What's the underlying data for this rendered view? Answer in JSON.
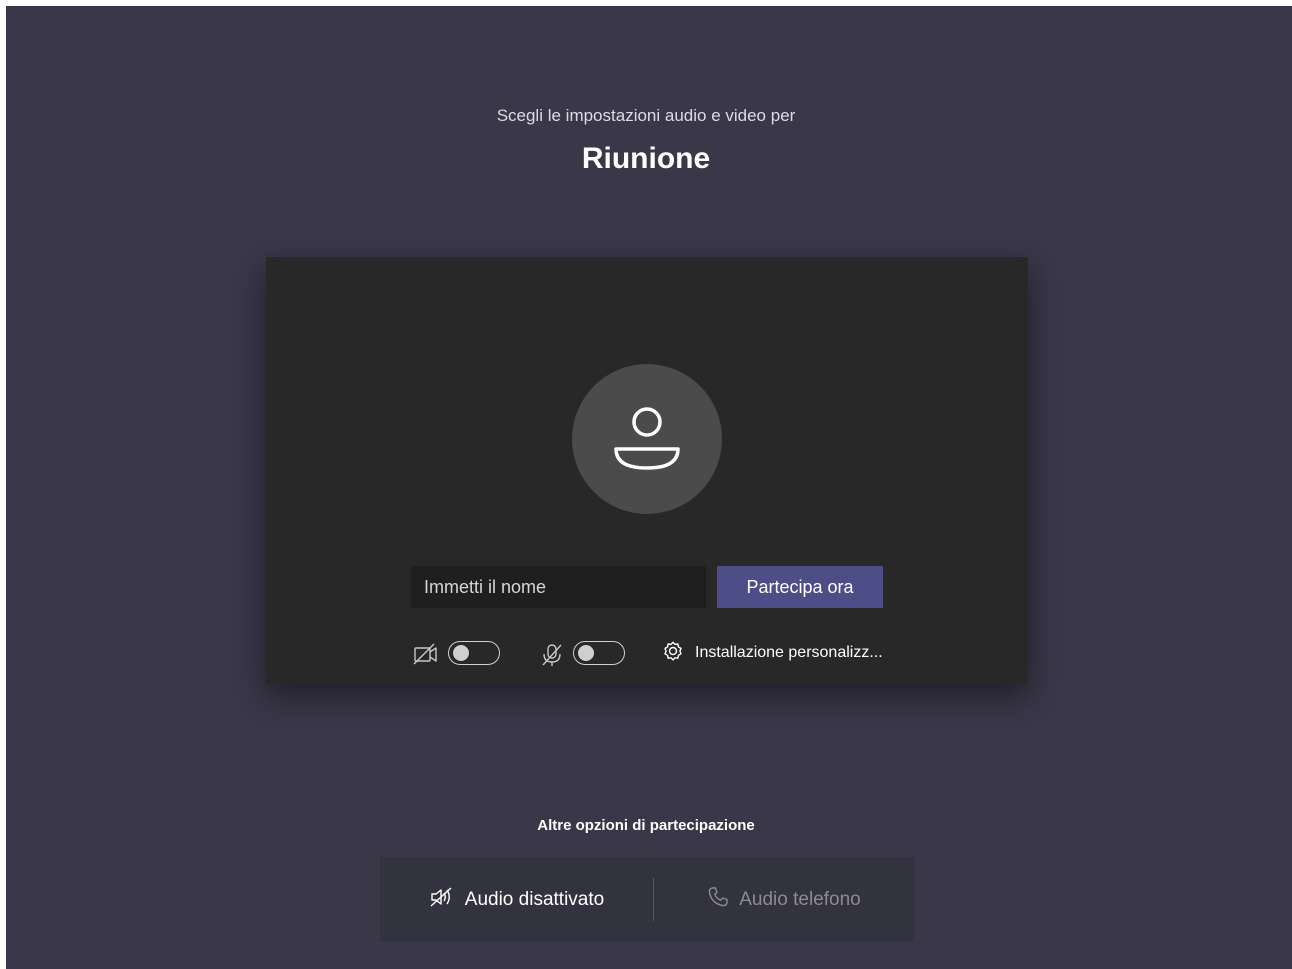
{
  "header": {
    "subtitle": "Scegli le impostazioni audio e video per",
    "title": "Riunione"
  },
  "join_card": {
    "name_placeholder": "Immetti il nome",
    "name_value": "",
    "join_button_label": "Partecipa ora",
    "camera_toggle": {
      "icon": "camera-off-icon",
      "state": "off"
    },
    "mic_toggle": {
      "icon": "mic-off-icon",
      "state": "off"
    },
    "settings_link": {
      "icon": "gear-icon",
      "label": "Installazione personalizz..."
    }
  },
  "other_options": {
    "heading": "Altre opzioni di partecipazione",
    "audio_off": {
      "icon": "speaker-off-icon",
      "label": "Audio disattivato"
    },
    "phone_audio": {
      "icon": "phone-icon",
      "label": "Audio telefono"
    }
  },
  "colors": {
    "background": "#393748",
    "card": "#282828",
    "accent": "#4d4d87",
    "avatar": "#4b4b4b"
  }
}
